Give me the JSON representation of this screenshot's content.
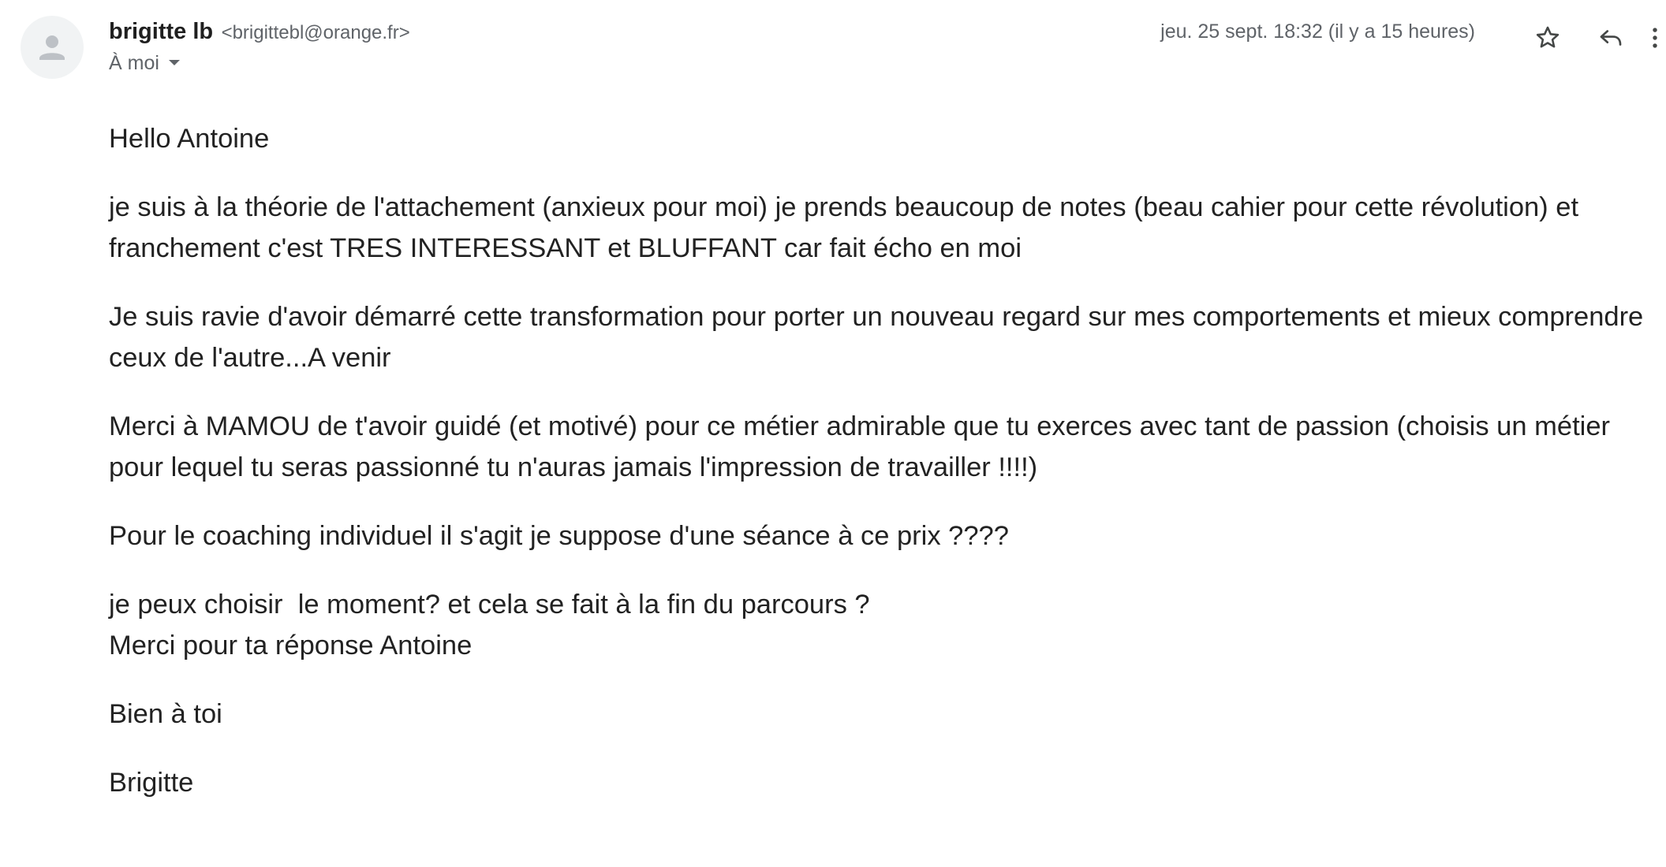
{
  "sender": {
    "name": "brigitte lb",
    "email": "<brigittebl@orange.fr>",
    "avatar_icon": "person-icon"
  },
  "recipient": {
    "label": "À moi"
  },
  "meta": {
    "date": "jeu. 25 sept. 18:32 (il y a 15 heures)"
  },
  "actions": {
    "star_icon": "star-icon",
    "reply_icon": "reply-icon",
    "more_icon": "more-vert-icon"
  },
  "message": {
    "greeting": "Hello Antoine",
    "paragraphs": [
      "je suis à la théorie de l'attachement (anxieux pour moi) je prends beaucoup de notes (beau cahier pour cette révolution) et franchement c'est TRES INTERESSANT et BLUFFANT car fait écho en moi",
      "Je suis ravie d'avoir démarré cette transformation pour porter un nouveau regard sur mes comportements et mieux comprendre ceux de l'autre...A venir",
      "Merci à MAMOU de t'avoir guidé (et motivé) pour ce métier admirable que tu exerces avec tant de passion (choisis un métier pour lequel tu seras passionné tu n'auras jamais l'impression de travailler !!!!)",
      "Pour le coaching individuel il s'agit je suppose d'une séance à ce prix ????",
      "je peux choisir  le moment? et cela se fait à la fin du parcours ?",
      "Merci pour ta réponse Antoine",
      "Bien à toi",
      "Brigitte"
    ]
  }
}
